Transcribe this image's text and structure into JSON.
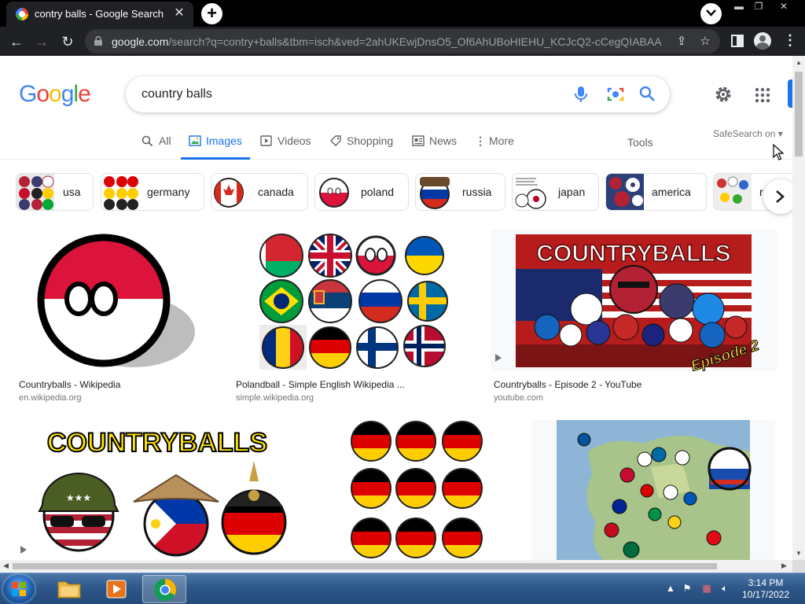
{
  "browser": {
    "tab_title": "contry balls - Google Search",
    "url_host": "google.com",
    "url_rest": "/search?q=contry+balls&tbm=isch&ved=2ahUKEwjDnsO5_Of6AhUBoHIEHU_KCJcQ2-cCegQIABAA&..."
  },
  "search": {
    "query": "country balls"
  },
  "tabs": [
    {
      "label": "All",
      "icon": "search-icon"
    },
    {
      "label": "Images",
      "icon": "image-icon",
      "active": true
    },
    {
      "label": "Videos",
      "icon": "video-icon"
    },
    {
      "label": "Shopping",
      "icon": "tag-icon"
    },
    {
      "label": "News",
      "icon": "news-icon"
    },
    {
      "label": "More",
      "icon": "more-vert-icon"
    }
  ],
  "tools_label": "Tools",
  "safesearch_label": "SafeSearch on",
  "chips": [
    "usa",
    "germany",
    "canada",
    "poland",
    "russia",
    "japan",
    "america",
    "r"
  ],
  "results": [
    {
      "title": "Countryballs - Wikipedia",
      "source": "en.wikipedia.org"
    },
    {
      "title": "Polandball - Simple English Wikipedia ...",
      "source": "simple.wikipedia.org"
    },
    {
      "title": "Countryballs - Episode 2 - YouTube",
      "source": "youtube.com"
    },
    {
      "title": "",
      "source": ""
    },
    {
      "title": "",
      "source": ""
    },
    {
      "title": "",
      "source": ""
    }
  ],
  "images": {
    "countryballs_banner": "COUNTRYBALLS",
    "episode_badge": "Episode 2"
  },
  "taskbar": {
    "time": "3:14 PM",
    "date": "10/17/2022"
  },
  "colors": {
    "google_blue": "#4285f4",
    "google_red": "#ea4335",
    "google_yellow": "#fbbc05",
    "google_green": "#34a853",
    "active_tab": "#1a73e8"
  }
}
